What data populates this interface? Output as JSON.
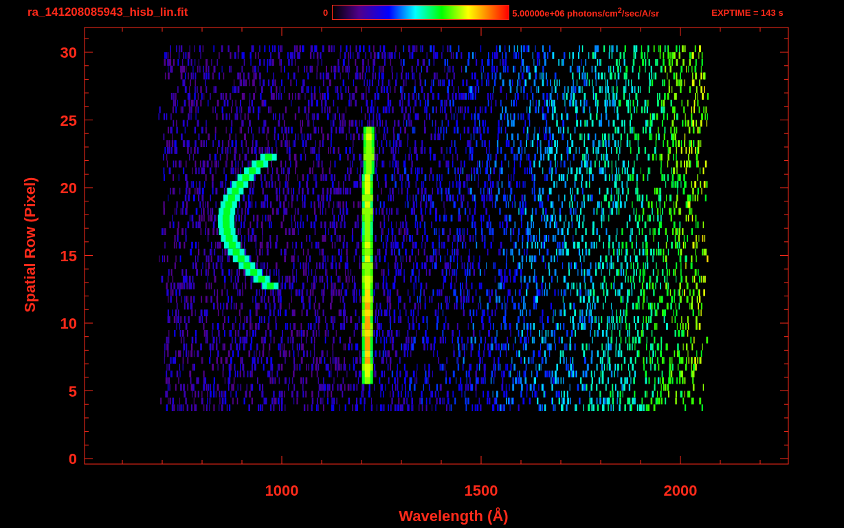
{
  "title": "ra_141208085943_hisb_lin.fit",
  "colorbar": {
    "min_label": "0",
    "max_label": "5.00000e+06 photons/cm$^{2}$/sec/A/sr"
  },
  "exposure": "EXPTIME = 143 s",
  "plot": {
    "xlabel": "Wavelength (Å)",
    "ylabel": "Spatial Row (Pixel)",
    "xticks": [
      "1000",
      "1500",
      "2000"
    ],
    "yticks": [
      "30",
      "25",
      "20",
      "15",
      "10",
      "5",
      "0"
    ]
  }
}
